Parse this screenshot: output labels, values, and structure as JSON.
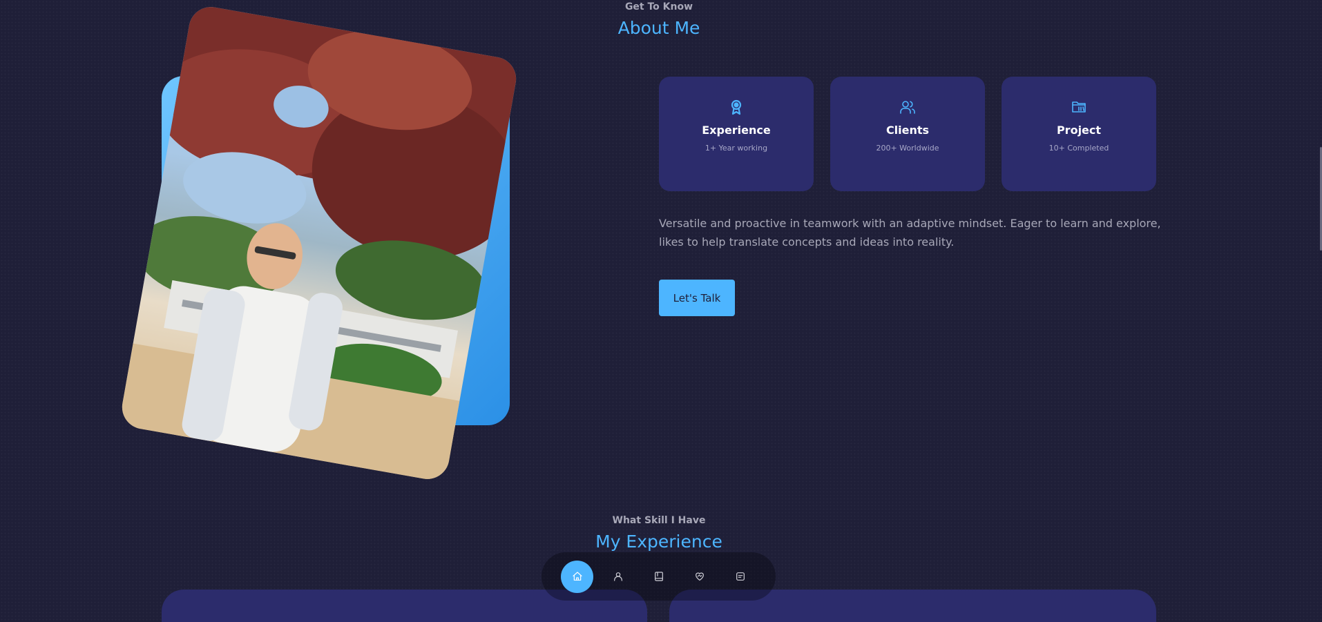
{
  "about": {
    "subtitle": "Get To Know",
    "title": "About Me",
    "cards": [
      {
        "title": "Experience",
        "sub": "1+ Year working",
        "icon": "award-icon"
      },
      {
        "title": "Clients",
        "sub": "200+ Worldwide",
        "icon": "users-icon"
      },
      {
        "title": "Project",
        "sub": "10+ Completed",
        "icon": "folder-icon"
      }
    ],
    "text": "Versatile and proactive in teamwork with an adaptive mindset. Eager to learn and explore, likes to help translate concepts and ideas into reality.",
    "button_label": "Let's Talk"
  },
  "experience": {
    "subtitle": "What Skill I Have",
    "title": "My Experience"
  },
  "nav": [
    {
      "icon": "home-icon",
      "active": true
    },
    {
      "icon": "user-icon",
      "active": false
    },
    {
      "icon": "book-icon",
      "active": false
    },
    {
      "icon": "heart-handshake-icon",
      "active": false
    },
    {
      "icon": "message-icon",
      "active": false
    }
  ],
  "colors": {
    "background": "#1f1f38",
    "accent": "#4db5ff",
    "card": "#2c2c6c"
  }
}
